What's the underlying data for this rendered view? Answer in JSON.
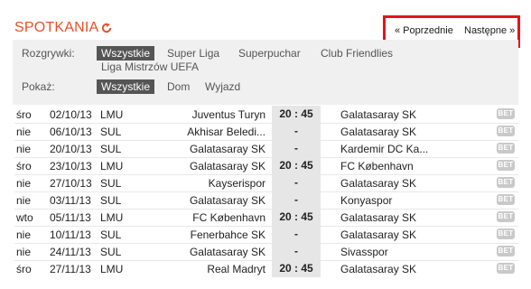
{
  "section": {
    "title": "SPOTKANIA",
    "title_icon": "circular-arrow-icon",
    "accent": "#e8502a"
  },
  "nav": {
    "prev_label": "« Poprzednie",
    "next_label": "Następne »",
    "highlight_color": "#e8121a"
  },
  "filters": {
    "competitions_label": "Rozgrywki:",
    "competitions": [
      {
        "label": "Wszystkie",
        "active": true
      },
      {
        "label": "Super Liga",
        "active": false
      },
      {
        "label": "Superpuchar",
        "active": false
      },
      {
        "label": "Club Friendlies",
        "active": false
      },
      {
        "label": "Liga Mistrzów UEFA",
        "active": false
      }
    ],
    "show_label": "Pokaż:",
    "show": [
      {
        "label": "Wszystkie",
        "active": true
      },
      {
        "label": "Dom",
        "active": false
      },
      {
        "label": "Wyjazd",
        "active": false
      }
    ]
  },
  "matches": [
    {
      "day": "śro",
      "date": "02/10/13",
      "comp": "LMU",
      "home": "Juventus Turyn",
      "score": "20 : 45",
      "away": "Galatasaray SK",
      "bet": "BET"
    },
    {
      "day": "nie",
      "date": "06/10/13",
      "comp": "SUL",
      "home": "Akhisar Beledi...",
      "score": "-",
      "away": "Galatasaray SK",
      "bet": "BET"
    },
    {
      "day": "nie",
      "date": "20/10/13",
      "comp": "SUL",
      "home": "Galatasaray SK",
      "score": "-",
      "away": "Kardemir DC Ka...",
      "bet": "BET"
    },
    {
      "day": "śro",
      "date": "23/10/13",
      "comp": "LMU",
      "home": "Galatasaray SK",
      "score": "20 : 45",
      "away": "FC København",
      "bet": "BET"
    },
    {
      "day": "nie",
      "date": "27/10/13",
      "comp": "SUL",
      "home": "Kayserispor",
      "score": "-",
      "away": "Galatasaray SK",
      "bet": "BET"
    },
    {
      "day": "nie",
      "date": "03/11/13",
      "comp": "SUL",
      "home": "Galatasaray SK",
      "score": "-",
      "away": "Konyaspor",
      "bet": "BET"
    },
    {
      "day": "wto",
      "date": "05/11/13",
      "comp": "LMU",
      "home": "FC København",
      "score": "20 : 45",
      "away": "Galatasaray SK",
      "bet": "BET"
    },
    {
      "day": "nie",
      "date": "10/11/13",
      "comp": "SUL",
      "home": "Fenerbahce SK",
      "score": "-",
      "away": "Galatasaray SK",
      "bet": "BET"
    },
    {
      "day": "nie",
      "date": "24/11/13",
      "comp": "SUL",
      "home": "Galatasaray SK",
      "score": "-",
      "away": "Sivasspor",
      "bet": "BET"
    },
    {
      "day": "śro",
      "date": "27/11/13",
      "comp": "LMU",
      "home": "Real Madryt",
      "score": "20 : 45",
      "away": "Galatasaray SK",
      "bet": "BET"
    }
  ]
}
